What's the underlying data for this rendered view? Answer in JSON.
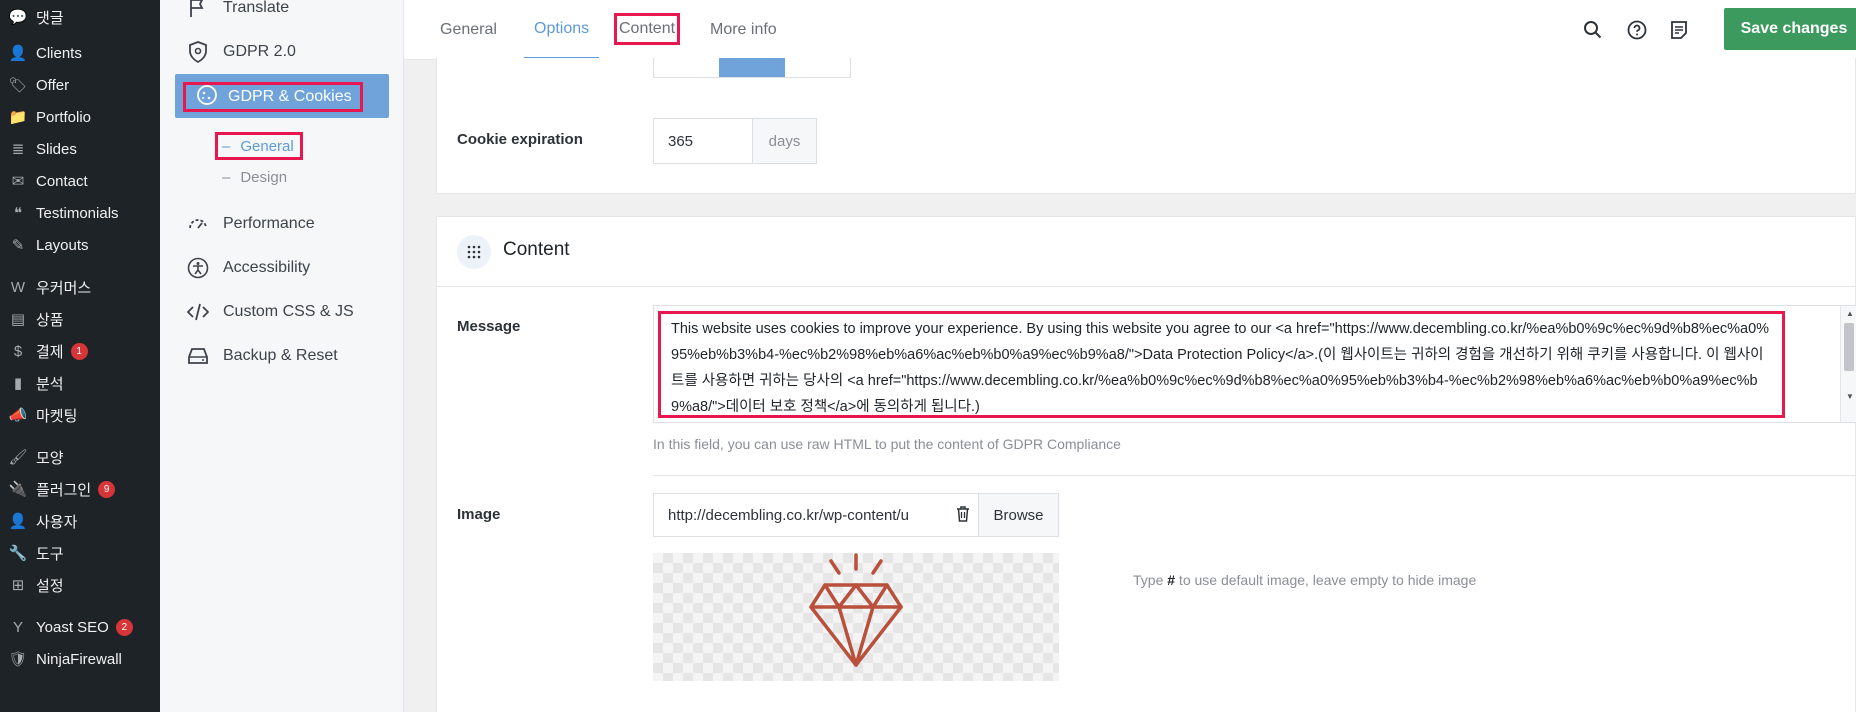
{
  "wp_menu": [
    {
      "icon": "comment-icon",
      "label": "댓글"
    },
    {
      "icon": "clients-icon",
      "label": "Clients"
    },
    {
      "icon": "offer-icon",
      "label": "Offer"
    },
    {
      "icon": "portfolio-icon",
      "label": "Portfolio"
    },
    {
      "icon": "slides-icon",
      "label": "Slides"
    },
    {
      "icon": "contact-icon",
      "label": "Contact"
    },
    {
      "icon": "quote-icon",
      "label": "Testimonials"
    },
    {
      "icon": "layouts-icon",
      "label": "Layouts"
    },
    {
      "icon": "woocommerce-icon",
      "label": "우커머스"
    },
    {
      "icon": "products-icon",
      "label": "상품"
    },
    {
      "icon": "payments-icon",
      "label": "결제",
      "badge": "1"
    },
    {
      "icon": "analytics-icon",
      "label": "분석"
    },
    {
      "icon": "marketing-icon",
      "label": "마켓팅"
    },
    {
      "icon": "appearance-icon",
      "label": "모양"
    },
    {
      "icon": "plugins-icon",
      "label": "플러그인",
      "badge": "9"
    },
    {
      "icon": "users-icon",
      "label": "사용자"
    },
    {
      "icon": "tools-icon",
      "label": "도구"
    },
    {
      "icon": "settings-icon",
      "label": "설정"
    },
    {
      "icon": "yoast-icon",
      "label": "Yoast SEO",
      "badge": "2"
    },
    {
      "icon": "ninjafirewall-icon",
      "label": "NinjaFirewall"
    }
  ],
  "plugin_nav": {
    "translate": "Translate",
    "gdpr2": "GDPR 2.0",
    "gdpr_cookies": "GDPR & Cookies",
    "sub_general": "General",
    "sub_design": "Design",
    "performance": "Performance",
    "accessibility": "Accessibility",
    "custom_css": "Custom CSS & JS",
    "backup": "Backup & Reset",
    "sub_dash": "–"
  },
  "tabs": {
    "general": "General",
    "options": "Options",
    "content": "Content",
    "more_info": "More info"
  },
  "save_label": "Save changes",
  "cookie_expiration": {
    "label": "Cookie expiration",
    "value": "365",
    "unit": "days"
  },
  "content_section": {
    "title": "Content",
    "message_label": "Message",
    "message_value": "This website uses cookies to improve your experience. By using this website you agree to our <a href=\"https://www.decembling.co.kr/%ea%b0%9c%ec%9d%b8%ec%a0%95%eb%b3%b4-%ec%b2%98%eb%a6%ac%eb%b0%a9%ec%b9%a8/\">Data Protection Policy</a>.(이 웹사이트는 귀하의 경험을 개선하기 위해 쿠키를 사용합니다. 이 웹사이트를 사용하면 귀하는 당사의 <a href=\"https://www.decembling.co.kr/%ea%b0%9c%ec%9d%b8%ec%a0%95%eb%b3%b4-%ec%b2%98%eb%a6%ac%eb%b0%a9%ec%b9%a8/\">데이터 보호 정책</a>에 동의하게 됩니다.)",
    "message_help": "In this field, you can use raw HTML to put the content of GDPR Compliance",
    "image_label": "Image",
    "image_value": "http://decembling.co.kr/wp-content/u",
    "browse_label": "Browse",
    "image_help_pre": "Type ",
    "image_help_hash": "#",
    "image_help_post": " to use default image, leave empty to hide image"
  },
  "colors": {
    "accent": "#5d9ad8",
    "save": "#3d9a5e",
    "highlight": "#e8174e",
    "diamond": "#b8503c"
  }
}
